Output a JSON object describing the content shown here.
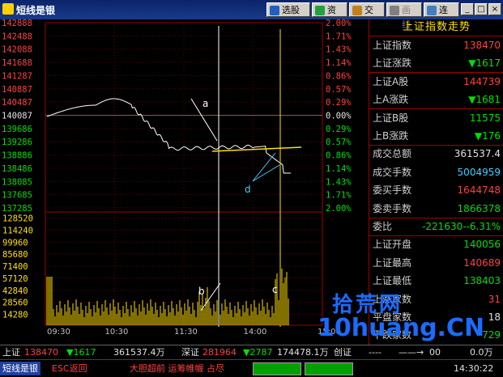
{
  "app": {
    "title": "短线是银"
  },
  "toolbar": {
    "buttons": [
      {
        "label": "选股",
        "icon": "stock-select-icon"
      },
      {
        "label": "资讯",
        "icon": "news-icon"
      },
      {
        "label": "交易",
        "icon": "trade-icon"
      },
      {
        "label": "画线",
        "icon": "draw-line-icon"
      },
      {
        "label": "连接",
        "icon": "connect-icon"
      }
    ],
    "window": {
      "minimize": "_",
      "restore": "□",
      "close": "×"
    }
  },
  "chart": {
    "price_axis_left": [
      "142888",
      "142488",
      "142088",
      "141688",
      "141287",
      "140887",
      "140487",
      "140087",
      "139686",
      "139286",
      "138886",
      "138486",
      "138085",
      "137685",
      "137285"
    ],
    "pct_axis_right": [
      "2.00%",
      "1.71%",
      "1.43%",
      "1.14%",
      "0.86%",
      "0.57%",
      "0.29%",
      "0.00%",
      "0.29%",
      "0.57%",
      "0.86%",
      "1.14%",
      "1.43%",
      "1.71%",
      "2.00%"
    ],
    "volume_axis": [
      "128520",
      "114240",
      "99960",
      "85680",
      "71400",
      "57120",
      "42840",
      "28560",
      "14280"
    ],
    "time_labels": [
      "09:30",
      "10:30",
      "11:30",
      "14:00",
      "15:00"
    ],
    "annotations": [
      "a",
      "b",
      "c",
      "d"
    ]
  },
  "panel": {
    "title": "上证指数走势",
    "rows": [
      {
        "label": "上证指数",
        "value": "138470",
        "color": "#ff4040"
      },
      {
        "label": "上证涨跌",
        "value": "▼1617",
        "color": "#00e000"
      },
      {
        "label": "上证A股",
        "value": "144739",
        "color": "#ff4040"
      },
      {
        "label": "上A涨跌",
        "value": "▼1681",
        "color": "#00e000"
      },
      {
        "label": "上证B股",
        "value": "11575",
        "color": "#00e000"
      },
      {
        "label": "上B涨跌",
        "value": "▼176",
        "color": "#00e000"
      },
      {
        "label": "成交总额",
        "value": "361537.4",
        "color": "#e0e0e0"
      },
      {
        "label": "成交手数",
        "value": "5004959",
        "color": "#40d0ff"
      },
      {
        "label": "委买手数",
        "value": "1644748",
        "color": "#ff4040"
      },
      {
        "label": "委卖手数",
        "value": "1866378",
        "color": "#00e000"
      },
      {
        "label": "委比",
        "value": "-221630--6.31%",
        "color": "#00e000"
      },
      {
        "label": "上证开盘",
        "value": "140056",
        "color": "#00e000"
      },
      {
        "label": "上证最高",
        "value": "140689",
        "color": "#ff4040"
      },
      {
        "label": "上证最低",
        "value": "138403",
        "color": "#00e000"
      },
      {
        "label": "上涨家数",
        "value": "31",
        "color": "#ff4040"
      },
      {
        "label": "平盘家数",
        "value": "18",
        "color": "#e0e0e0"
      },
      {
        "label": "下跌家数",
        "value": "729",
        "color": "#00e000"
      }
    ]
  },
  "status": {
    "sh_label": "上证",
    "sh_value": "138470",
    "sh_change": "▼1617",
    "sh_amount": "361537.4万",
    "sz_label": "深证",
    "sz_value": "281964",
    "sz_change": "▼2787",
    "sz_amount": "174478.1万",
    "gem_label": "创证",
    "gem_value": "----",
    "gem_arrow": "——→",
    "gem_change": "00",
    "gem_amount": "0.0万"
  },
  "bottom": {
    "badge": "短线是银",
    "hint": "ESC返回",
    "ticker": "大胆超前  运筹帷幄  占尽",
    "time": "14:30:22"
  },
  "watermark": {
    "top": "拾荒网",
    "bottom": "10huang.CN"
  }
}
